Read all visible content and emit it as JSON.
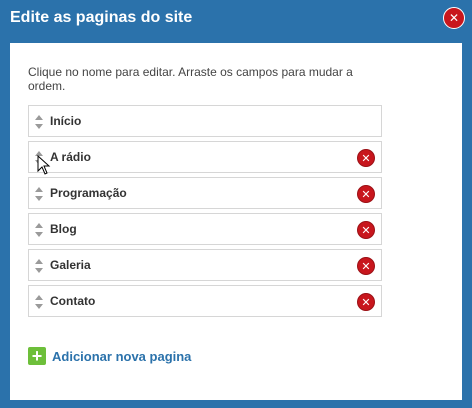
{
  "dialog": {
    "title": "Edite as paginas do site",
    "close_icon": "close-icon"
  },
  "panel": {
    "hint": "Clique no nome para editar. Arraste os campos para mudar a ordem."
  },
  "pages": [
    {
      "label": "Início",
      "deletable": false
    },
    {
      "label": "A rádio",
      "deletable": true
    },
    {
      "label": "Programação",
      "deletable": true
    },
    {
      "label": "Blog",
      "deletable": true
    },
    {
      "label": "Galeria",
      "deletable": true
    },
    {
      "label": "Contato",
      "deletable": true
    }
  ],
  "add_page": {
    "label": "Adicionar nova pagina",
    "icon": "plus-icon"
  },
  "colors": {
    "header": "#2b72ab",
    "delete": "#c8161d",
    "add": "#6dbf3a"
  }
}
